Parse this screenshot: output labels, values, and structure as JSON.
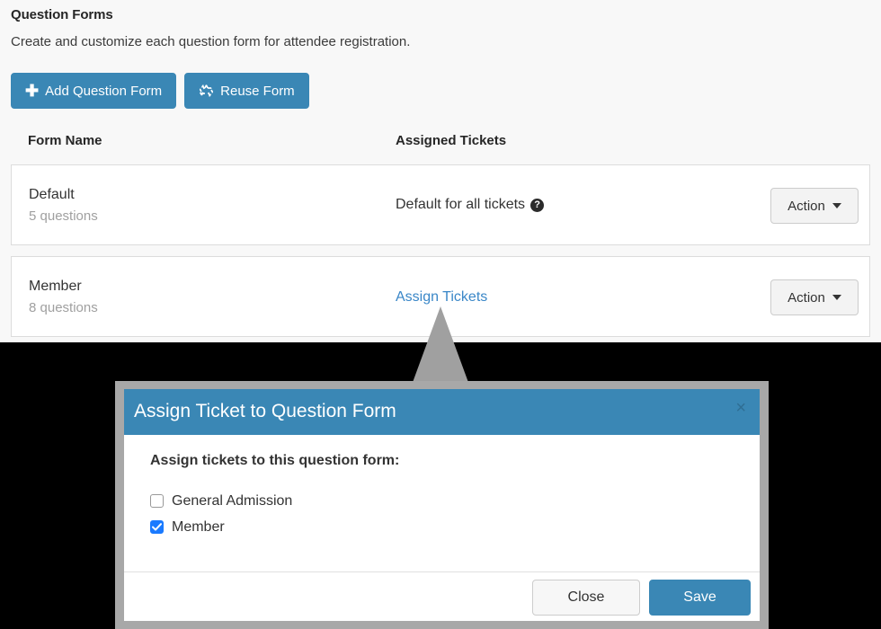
{
  "page": {
    "title": "Question Forms",
    "description": "Create and customize each question form for attendee registration.",
    "background_color": "#f8f8f8",
    "accent_color": "#3a87b5"
  },
  "toolbar": {
    "add_label": "Add Question Form",
    "add_icon": "plus-icon",
    "reuse_label": "Reuse Form",
    "reuse_icon": "recycle-icon"
  },
  "table": {
    "columns": [
      "Form Name",
      "Assigned Tickets"
    ],
    "rows": [
      {
        "name": "Default",
        "question_count": "5 questions",
        "assigned": "Default for all tickets",
        "assigned_is_link": false,
        "help_icon": "question-mark-icon",
        "help_glyph": "?",
        "action_label": "Action"
      },
      {
        "name": "Member",
        "question_count": "8 questions",
        "assigned": "Assign Tickets",
        "assigned_is_link": true,
        "action_label": "Action"
      }
    ]
  },
  "modal": {
    "title": "Assign Ticket to Question Form",
    "close_glyph": "×",
    "body_label": "Assign tickets to this question form:",
    "tickets": [
      {
        "label": "General Admission",
        "checked": false
      },
      {
        "label": "Member",
        "checked": true
      }
    ],
    "close_button": "Close",
    "save_button": "Save",
    "header_color": "#3a87b5",
    "checked_color": "#1a7aff"
  }
}
